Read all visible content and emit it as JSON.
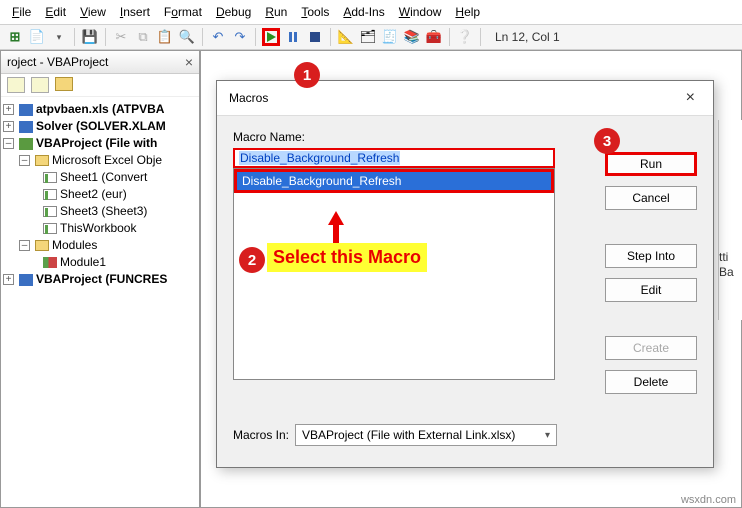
{
  "menubar": [
    "File",
    "Edit",
    "View",
    "Insert",
    "Format",
    "Debug",
    "Run",
    "Tools",
    "Add-Ins",
    "Window",
    "Help"
  ],
  "status": "Ln 12, Col 1",
  "project_panel": {
    "title": "roject - VBAProject",
    "nodes": {
      "atp": "atpvbaen.xls (ATPVBA",
      "solver": "Solver (SOLVER.XLAM",
      "vbaproj": "VBAProject (File with",
      "excel_objs": "Microsoft Excel Obje",
      "sheet1": "Sheet1 (Convert",
      "sheet2": "Sheet2 (eur)",
      "sheet3": "Sheet3 (Sheet3)",
      "thiswb": "ThisWorkbook",
      "modules": "Modules",
      "module1": "Module1",
      "funcres": "VBAProject (FUNCRES"
    }
  },
  "dialog": {
    "title": "Macros",
    "macro_name_label": "Macro Name:",
    "macro_name_value": "Disable_Background_Refresh",
    "list_item": "Disable_Background_Refresh",
    "buttons": {
      "run": "Run",
      "cancel": "Cancel",
      "step_into": "Step Into",
      "edit": "Edit",
      "create": "Create",
      "delete": "Delete"
    },
    "macros_in_label": "Macros In:",
    "macros_in_value": "VBAProject (File with External Link.xlsx)"
  },
  "callouts": {
    "c1": "1",
    "c2": "2",
    "c3": "3",
    "label": "Select this Macro"
  },
  "right_strip": "tti\nBa",
  "watermark": "wsxdn.com"
}
